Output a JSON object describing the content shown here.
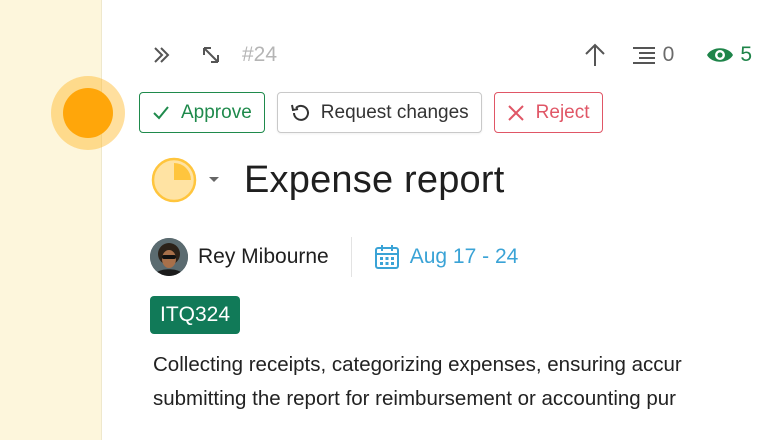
{
  "toolbar": {
    "task_id": "#24",
    "comments_count": "0",
    "watchers_count": "5",
    "icons": [
      "expand-right-icon",
      "resize-diagonal-icon",
      "arrow-up-icon",
      "comments-icon",
      "eye-icon"
    ],
    "colors": {
      "watchers": "#1e8449"
    }
  },
  "actions": {
    "approve_label": "Approve",
    "request_changes_label": "Request changes",
    "reject_label": "Reject",
    "colors": {
      "approve": "#1f8a4c",
      "reject": "#e05666"
    }
  },
  "task": {
    "title": "Expense report",
    "status_icon": "progress-pie-icon",
    "status_color": "#ffc53d",
    "assignee": "Rey Mibourne",
    "date_range": "Aug 17 - 24",
    "tag": "ITQ324",
    "tag_color": "#117a58",
    "description_lines": [
      "Collecting receipts, categorizing expenses, ensuring accur",
      "submitting the report for reimbursement or accounting pur"
    ]
  }
}
